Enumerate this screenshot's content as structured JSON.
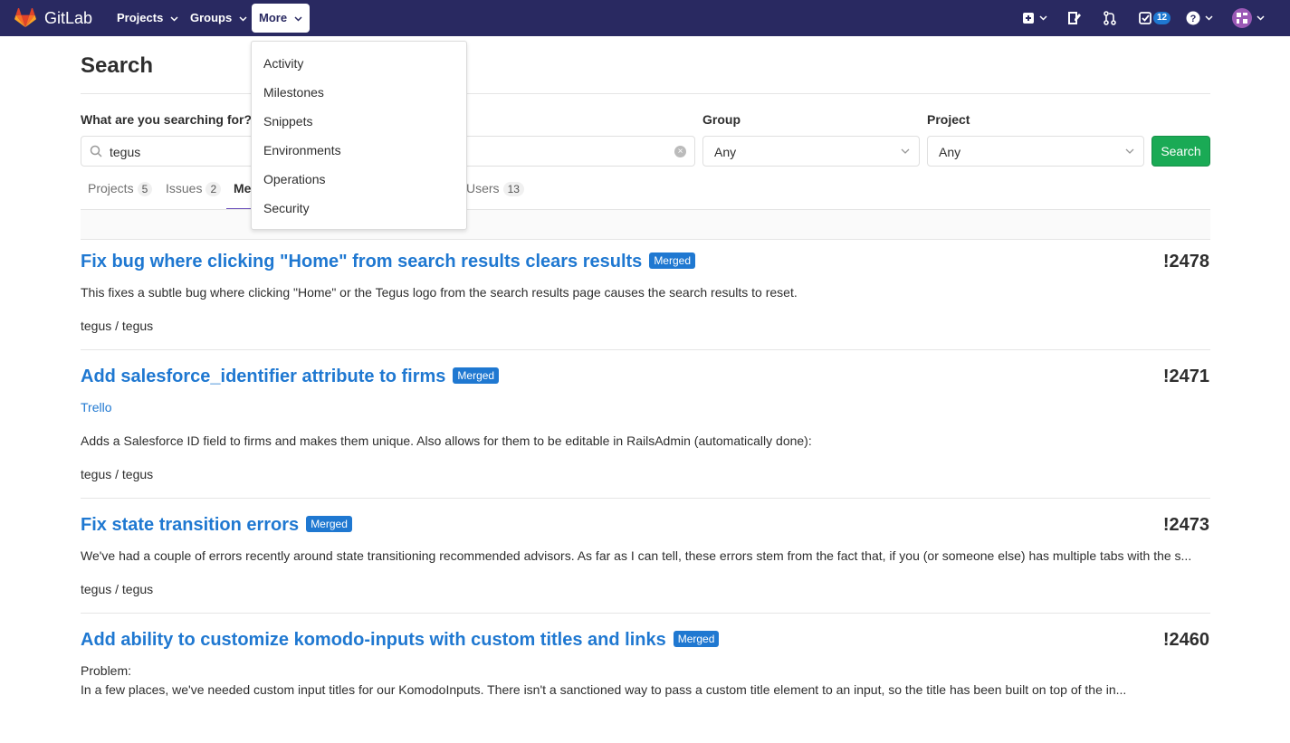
{
  "navbar": {
    "brand": "GitLab",
    "projects_label": "Projects",
    "groups_label": "Groups",
    "more_label": "More",
    "todos_count": "12",
    "colors": {
      "background": "#292961",
      "badge": "#1f78d1"
    }
  },
  "more_menu": {
    "items": [
      {
        "label": "Activity"
      },
      {
        "label": "Milestones"
      },
      {
        "label": "Snippets"
      },
      {
        "label": "Environments"
      },
      {
        "label": "Operations"
      },
      {
        "label": "Security"
      }
    ]
  },
  "page": {
    "title": "Search",
    "search_label": "What are you searching for?",
    "search_value": "tegus",
    "group_label": "Group",
    "group_value": "Any",
    "project_label": "Project",
    "project_value": "Any",
    "search_button": "Search"
  },
  "tabs": [
    {
      "label": "Projects",
      "count": "5"
    },
    {
      "label": "Issues",
      "count": "2"
    },
    {
      "label": "Me",
      "count": ""
    },
    {
      "label": "Users",
      "count": "13"
    }
  ],
  "results": [
    {
      "title": "Fix bug where clicking \"Home\" from search results clears results",
      "badge": "Merged",
      "iid": "!2478",
      "description": "This fixes a subtle bug where clicking \"Home\" or the Tegus logo from the search results page causes the search results to reset.",
      "project": "tegus / tegus"
    },
    {
      "title": "Add salesforce_identifier attribute to firms",
      "badge": "Merged",
      "iid": "!2471",
      "link": "Trello",
      "description": "Adds a Salesforce ID field to firms and makes them unique. Also allows for them to be editable in RailsAdmin (automatically done):",
      "project": "tegus / tegus"
    },
    {
      "title": "Fix state transition errors",
      "badge": "Merged",
      "iid": "!2473",
      "description": "We've had a couple of errors recently around state transitioning recommended advisors. As far as I can tell, these errors stem from the fact that, if you (or someone else) has multiple tabs with the s...",
      "project": "tegus / tegus"
    },
    {
      "title": "Add ability to customize komodo-inputs with custom titles and links",
      "badge": "Merged",
      "iid": "!2460",
      "description_line1": "Problem:",
      "description_line2": "In a few places, we've needed custom input titles for our KomodoInputs. There isn't a sanctioned way to pass a custom title element to an input, so the title has been built on top of the in..."
    }
  ]
}
